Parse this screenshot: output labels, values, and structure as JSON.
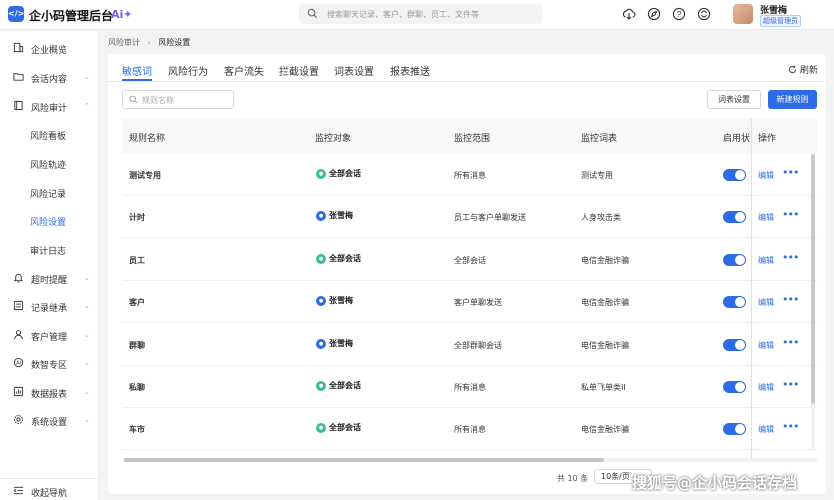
{
  "app": {
    "logo_text": "</>",
    "title": "企小码管理后台",
    "ai_badge": "Ai✦"
  },
  "search": {
    "placeholder": "搜索聊天记录、客户、群聊、员工、文件等"
  },
  "top_icons": [
    "cloud-download-icon",
    "compass-icon",
    "help-icon",
    "sync-icon"
  ],
  "user": {
    "name": "张雪梅",
    "role": "超级管理员"
  },
  "sidebar": {
    "items": [
      {
        "label": "企业概览",
        "icon": "building-icon"
      },
      {
        "label": "会话内容",
        "icon": "folder-icon"
      },
      {
        "label": "风险审计",
        "icon": "book-icon",
        "expanded": true
      },
      {
        "label": "风险看板"
      },
      {
        "label": "风险轨迹"
      },
      {
        "label": "风险记录"
      },
      {
        "label": "风险设置",
        "active": true
      },
      {
        "label": "审计日志"
      },
      {
        "label": "超时提醒",
        "icon": "bell-icon"
      },
      {
        "label": "记录继承",
        "icon": "transfer-icon"
      },
      {
        "label": "客户管理",
        "icon": "user-icon"
      },
      {
        "label": "数智专区",
        "icon": "brain-icon"
      },
      {
        "label": "数据报表",
        "icon": "chart-icon"
      },
      {
        "label": "系统设置",
        "icon": "gear-icon"
      }
    ],
    "collapse_label": "收起导航"
  },
  "breadcrumb": {
    "parent": "风险审计",
    "separator": "›",
    "current": "风险设置"
  },
  "tabs": [
    "敏感词",
    "风险行为",
    "客户流失",
    "拦截设置",
    "词表设置",
    "报表推送"
  ],
  "toolbar": {
    "refresh_label": "刷新",
    "filter_placeholder": "规则名称",
    "dict_button": "词表设置",
    "new_button": "新建规则"
  },
  "table": {
    "headers": [
      "规则名称",
      "监控对象",
      "监控范围",
      "监控词表",
      "启用状",
      "操作"
    ],
    "rows": [
      {
        "name": "测试专用",
        "target": "全部会话",
        "target_icon": "group",
        "scope": "所有消息",
        "dict": "测试专用",
        "enabled": true
      },
      {
        "name": "计时",
        "target": "张雪梅",
        "target_icon": "person",
        "scope": "员工与客户单聊发送",
        "dict": "人身攻击类",
        "enabled": true
      },
      {
        "name": "员工",
        "target": "全部会话",
        "target_icon": "group",
        "scope": "全部会话",
        "dict": "电信金融诈骗",
        "enabled": true
      },
      {
        "name": "客户",
        "target": "张雪梅",
        "target_icon": "person",
        "scope": "客户单聊发送",
        "dict": "电信金融诈骗",
        "enabled": true
      },
      {
        "name": "群聊",
        "target": "张雪梅",
        "target_icon": "person",
        "scope": "全部群聊会话",
        "dict": "电信金融诈骗",
        "enabled": true
      },
      {
        "name": "私聊",
        "target": "全部会话",
        "target_icon": "group",
        "scope": "所有消息",
        "dict": "私单飞单类II",
        "enabled": true
      },
      {
        "name": "车市",
        "target": "全部会话",
        "target_icon": "group",
        "scope": "所有消息",
        "dict": "电信金融诈骗",
        "enabled": true
      }
    ],
    "edit_label": "编辑",
    "more_label": "•••"
  },
  "pagination": {
    "total": "共 10 条",
    "page_size": "10条/页"
  },
  "watermark": "搜狐号@企小码会话存档",
  "colors": {
    "accent": "#2e6be6",
    "ai": "#7b5cf5",
    "group_icon": "#3dbf8a"
  }
}
